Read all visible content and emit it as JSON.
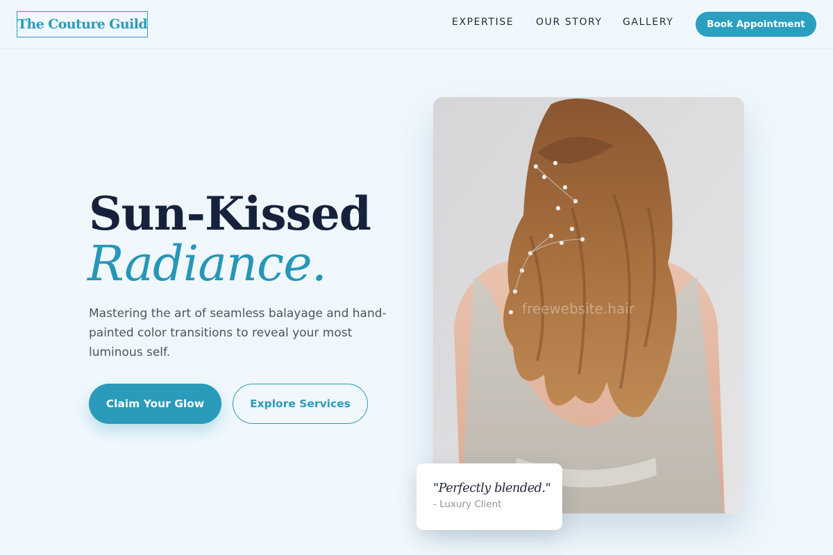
{
  "header": {
    "logo": "The Couture Guild",
    "nav": [
      "EXPERTISE",
      "OUR STORY",
      "GALLERY"
    ],
    "book_button": "Book Appointment"
  },
  "hero": {
    "headline_line1": "Sun-Kissed",
    "headline_line2": "Radiance.",
    "intro": "Mastering the art of seamless balayage and hand-painted color transitions to reveal your most luminous self.",
    "primary_cta": "Claim Your Glow",
    "secondary_cta": "Explore Services",
    "photo": {
      "watermark": "freewebsite.hair"
    },
    "testimonial": {
      "quote": "\"Perfectly blended.\"",
      "author": "- Luxury Client"
    }
  },
  "colors": {
    "accent": "#2a9bba",
    "background": "#f0f8fd",
    "heading": "#16213b"
  }
}
